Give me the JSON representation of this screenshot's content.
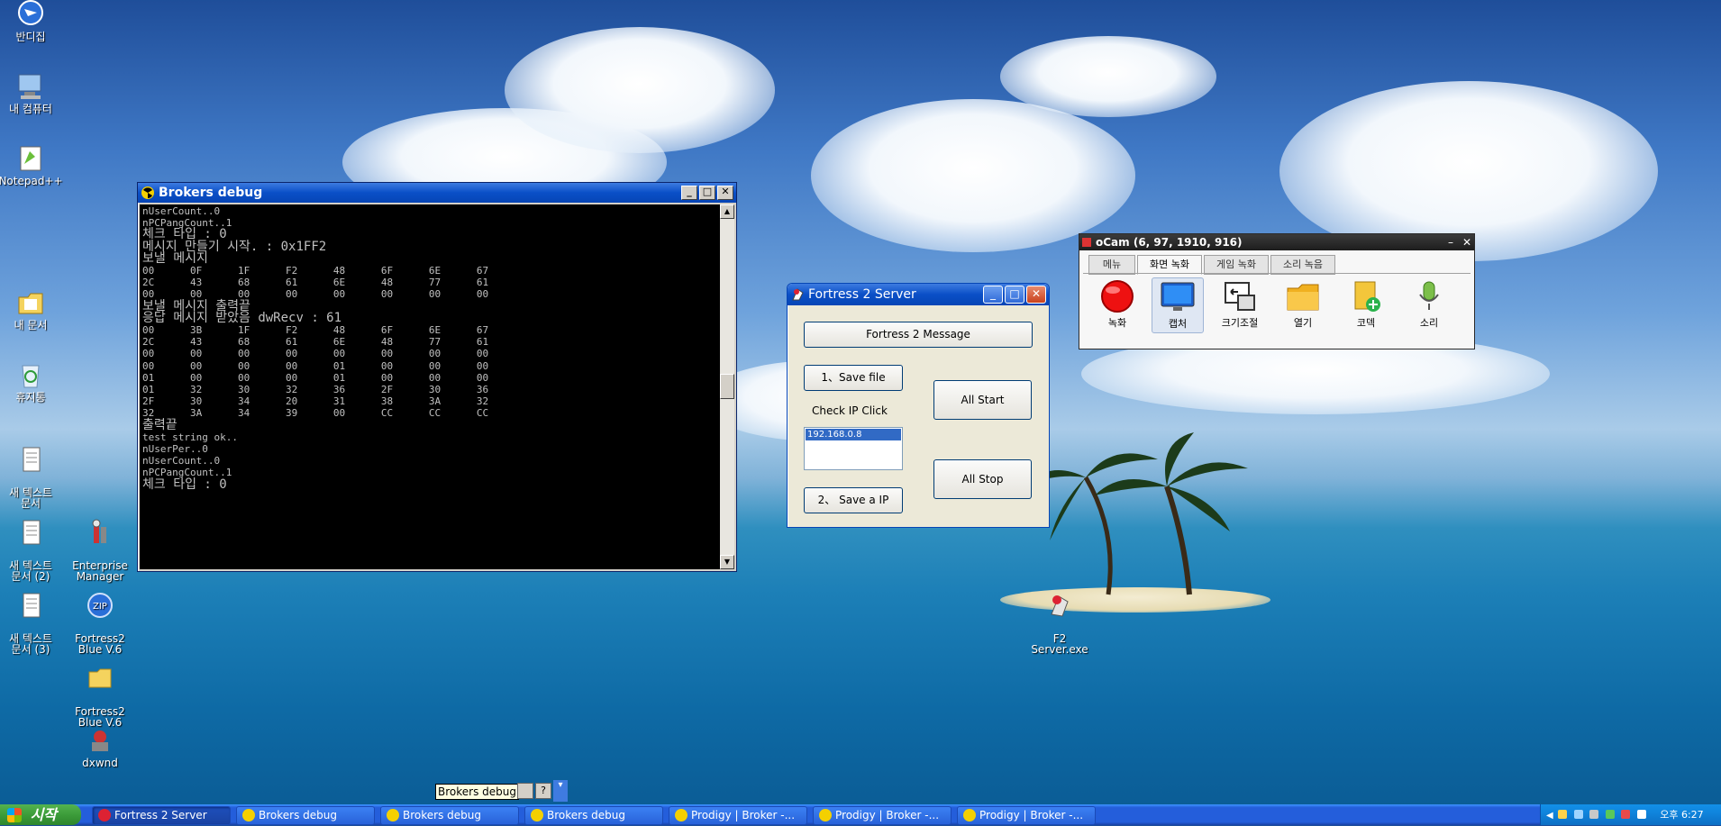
{
  "desktop": {
    "icons": [
      {
        "label": "반디집",
        "icon": "bandizip-icon"
      },
      {
        "label": "내 컴퓨터",
        "icon": "my-computer-icon"
      },
      {
        "label": "Notepad++",
        "icon": "notepadpp-icon"
      },
      {
        "label": "내 문서",
        "icon": "my-documents-icon"
      },
      {
        "label": "휴지통",
        "icon": "recycle-bin-icon"
      },
      {
        "label": "새 텍스트\n문서",
        "icon": "text-document-icon"
      },
      {
        "label": "새 텍스트\n문서 (2)",
        "icon": "text-document-icon"
      },
      {
        "label": "새 텍스트\n문서 (3)",
        "icon": "text-document-icon"
      },
      {
        "label": "Enterprise\nManager",
        "icon": "enterprise-manager-icon"
      },
      {
        "label": "Fortress2\nBlue V.6",
        "icon": "zip-archive-icon"
      },
      {
        "label": "Fortress2\nBlue V.6",
        "icon": "folder-icon"
      },
      {
        "label": "dxwnd",
        "icon": "dxwnd-icon"
      },
      {
        "label": "F2\nServer.exe",
        "icon": "server-exe-icon"
      }
    ]
  },
  "console_window": {
    "title": "Brokers debug",
    "lines": [
      "nUserCount..0",
      "nPCPangCount..1",
      "체크 타입 : 0",
      "메시지 만들기 시작. : 0x1FF2",
      "보낼 메시지",
      "00      0F      1F      F2      48      6F      6E      67",
      "2C      43      68      61      6E      48      77      61",
      "00      00      00      00      00      00      00      00",
      "보낼 메시지 출력끝",
      "응답 메시지 받았음 dwRecv : 61",
      "00      3B      1F      F2      48      6F      6E      67",
      "2C      43      68      61      6E      48      77      61",
      "00      00      00      00      00      00      00      00",
      "00      00      00      00      01      00      00      00",
      "01      00      00      00      01      00      00      00",
      "01      32      30      32      36      2F      30      36",
      "2F      30      34      20      31      38      3A      32",
      "32      3A      34      39      00      CC      CC      CC",
      "출력끝",
      "test string ok..",
      "nUserPer..0",
      "nUserCount..0",
      "nPCPangCount..1",
      "체크 타입 : 0"
    ]
  },
  "server_window": {
    "title": "Fortress 2 Server",
    "message_button": "Fortress 2 Message",
    "save_file_button": "1、Save file",
    "check_ip_label": "Check IP Click",
    "ip_list": [
      "192.168.0.8"
    ],
    "save_ip_button": "2、 Save a IP",
    "all_start_button": "All Start",
    "all_stop_button": "All Stop"
  },
  "ocam_window": {
    "title": "oCam (6, 97, 1910, 916)",
    "tabs": [
      "메뉴",
      "화면 녹화",
      "게임 녹화",
      "소리 녹음"
    ],
    "active_tab": "화면 녹화",
    "tools": [
      {
        "label": "녹화",
        "icon": "record-icon"
      },
      {
        "label": "캡처",
        "icon": "monitor-capture-icon"
      },
      {
        "label": "크기조절",
        "icon": "resize-icon"
      },
      {
        "label": "열기",
        "icon": "open-folder-icon"
      },
      {
        "label": "코덱",
        "icon": "codec-icon"
      },
      {
        "label": "소리",
        "icon": "microphone-icon"
      }
    ]
  },
  "tooltip": {
    "text": "Brokers debug"
  },
  "taskbar": {
    "start_label": "시작",
    "tasks": [
      {
        "label": "Fortress 2 Server",
        "active": true
      },
      {
        "label": "Brokers debug"
      },
      {
        "label": "Brokers debug"
      },
      {
        "label": "Brokers debug"
      },
      {
        "label": "Prodigy | Broker -..."
      },
      {
        "label": "Prodigy | Broker -..."
      },
      {
        "label": "Prodigy | Broker -..."
      }
    ],
    "clock": "오후 6:27"
  },
  "colors": {
    "xp_title": "#0a4fc7",
    "taskbar": "#245edb",
    "start": "#3c9c3a",
    "console_bg": "#000000"
  }
}
